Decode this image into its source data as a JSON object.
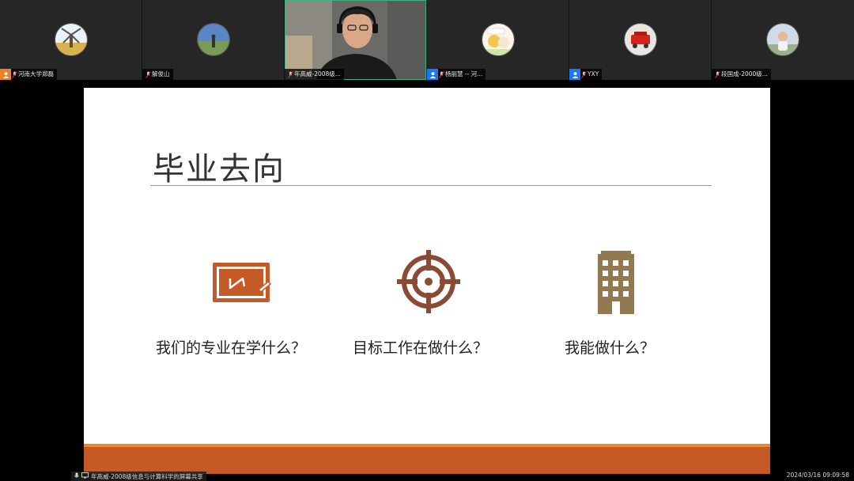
{
  "participants": [
    {
      "name": "河南大学郑磊",
      "badge": "orange"
    },
    {
      "name": "解俊山",
      "badge": ""
    },
    {
      "name": "年高威-2008级...",
      "badge": ""
    },
    {
      "name": "杨丽慧 -- 河...",
      "badge": "blue"
    },
    {
      "name": "YXY",
      "badge": "blue"
    },
    {
      "name": "段国成-2000级...",
      "badge": ""
    }
  ],
  "slide": {
    "title": "毕业去向",
    "questions": [
      "我们的专业在学什么？",
      "目标工作在做什么？",
      "我能做什么？"
    ],
    "icons": [
      "blackboard-icon",
      "target-icon",
      "building-icon"
    ]
  },
  "share_label": "年高威-2008级信息与计算科学的屏幕共享",
  "timestamp": "2024/03/16 09:09:58",
  "colors": {
    "accent": "#c55a27",
    "accent_light": "#ee8a2a",
    "target": "#8b4a33",
    "building": "#94784f"
  }
}
